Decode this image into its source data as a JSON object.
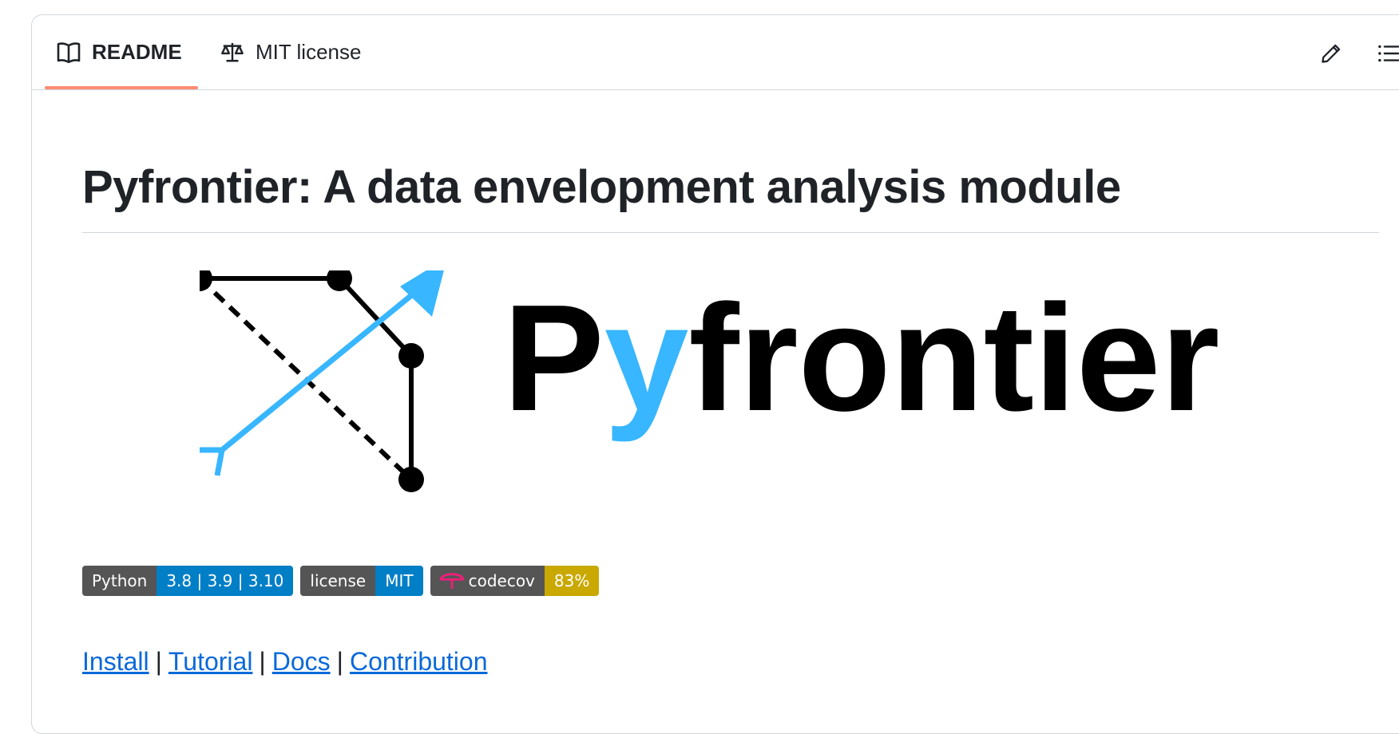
{
  "tabs": [
    {
      "label": "README",
      "icon": "book-icon",
      "active": true
    },
    {
      "label": "MIT license",
      "icon": "law-scale-icon",
      "active": false
    }
  ],
  "toolbar": {
    "edit_icon": "pencil-icon",
    "outline_icon": "list-unordered-icon"
  },
  "readme": {
    "title": "Pyfrontier: A data envelopment analysis module",
    "logo": {
      "text_prefix": "P",
      "text_accent": "y",
      "text_suffix": "frontier",
      "accent_color": "#38b6ff"
    },
    "badges": [
      {
        "label": "Python",
        "value": "3.8 | 3.9 | 3.10",
        "value_color": "#007ec6"
      },
      {
        "label": "license",
        "value": "MIT",
        "value_color": "#007ec6"
      },
      {
        "label": "codecov",
        "value": "83%",
        "value_color": "#c9a800",
        "icon": "codecov-umbrella-icon"
      }
    ],
    "links": [
      "Install",
      "Tutorial",
      "Docs",
      "Contribution"
    ],
    "link_separator": "|"
  },
  "colors": {
    "tab_underline": "#fd8c73",
    "link": "#0969da",
    "border": "#d0d7de"
  }
}
